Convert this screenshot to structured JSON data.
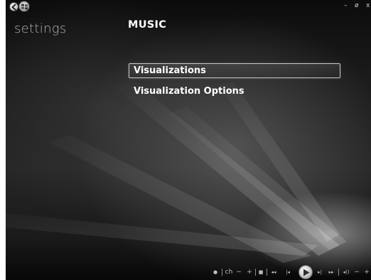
{
  "header": {
    "section_title": "settings",
    "page_title": "MUSIC"
  },
  "window_controls": {
    "minimize": "–",
    "restore": "ø",
    "close": "x"
  },
  "menu": {
    "items": [
      {
        "label": "Visualizations",
        "selected": true
      },
      {
        "label": "Visualization Options",
        "selected": false
      }
    ]
  },
  "transport": {
    "record": "●",
    "channel": "ch",
    "channel_down": "−",
    "channel_up": "+",
    "stop": "■",
    "rewind": "◂◂",
    "previous": "|◂",
    "next": "▸|",
    "fast_forward": "▸▸",
    "mute": "◂))",
    "volume_down": "−",
    "volume_up": "+"
  },
  "icons": {
    "back": "back-arrow-icon",
    "start": "windows-flag-icon",
    "play": "play-icon"
  },
  "colors": {
    "background_dark": "#0c0c0c",
    "text_primary": "#ffffff",
    "text_muted": "#b5b5b5",
    "focus_border": "#c9c9c9"
  }
}
